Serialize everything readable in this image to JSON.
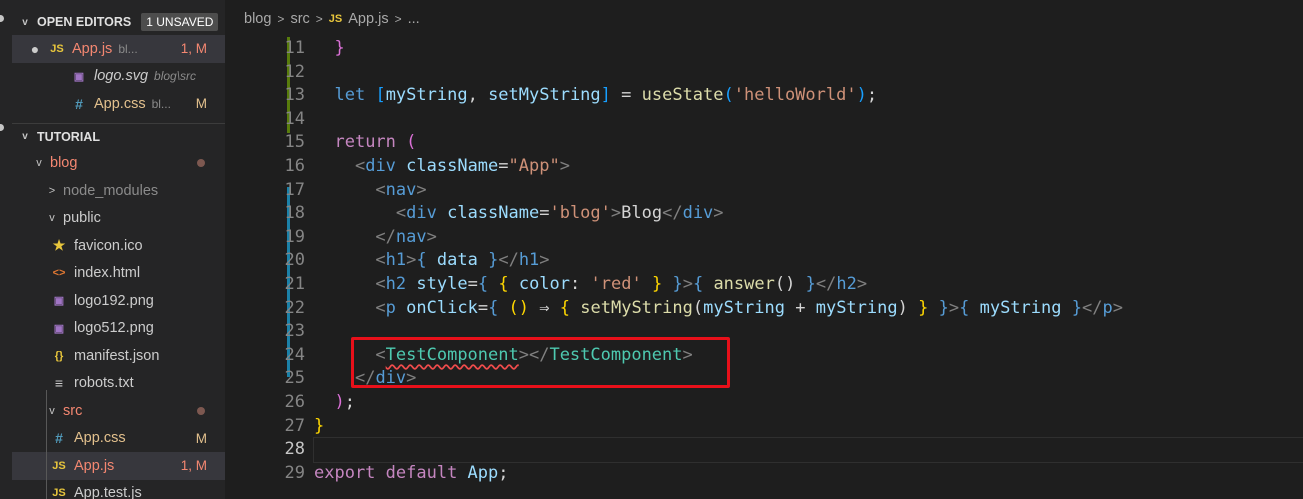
{
  "breadcrumb": {
    "items": [
      "blog",
      "src",
      "App.js",
      "..."
    ],
    "file_icon": "JS"
  },
  "sidebar": {
    "open_editors": {
      "title": "OPEN EDITORS",
      "badge": "1 UNSAVED",
      "files": [
        {
          "icon": "JS",
          "name": "App.js",
          "path": "bl...",
          "status": "1, M"
        },
        {
          "icon": "svg",
          "name": "logo.svg",
          "path": "blog\\src",
          "status": ""
        },
        {
          "icon": "#",
          "name": "App.css",
          "path": "bl...",
          "status": "M"
        }
      ]
    },
    "tutorial": {
      "title": "TUTORIAL",
      "tree": [
        {
          "label": "blog"
        },
        {
          "label": "node_modules"
        },
        {
          "label": "public"
        },
        {
          "label": "favicon.ico"
        },
        {
          "label": "index.html"
        },
        {
          "label": "logo192.png"
        },
        {
          "label": "logo512.png"
        },
        {
          "label": "manifest.json"
        },
        {
          "label": "robots.txt"
        },
        {
          "label": "src"
        },
        {
          "label": "App.css",
          "status": "M"
        },
        {
          "label": "App.js",
          "status": "1, M"
        },
        {
          "label": "App.test.js"
        }
      ]
    }
  },
  "editor": {
    "line_numbers": [
      "11",
      "12",
      "13",
      "14",
      "15",
      "16",
      "17",
      "18",
      "19",
      "20",
      "21",
      "22",
      "23",
      "24",
      "25",
      "26",
      "27",
      "28",
      "29"
    ],
    "current_line": "28"
  },
  "colors": {
    "highlight_box": "#e8101a",
    "background": "#1e1e1e",
    "sidebar": "#252526"
  }
}
